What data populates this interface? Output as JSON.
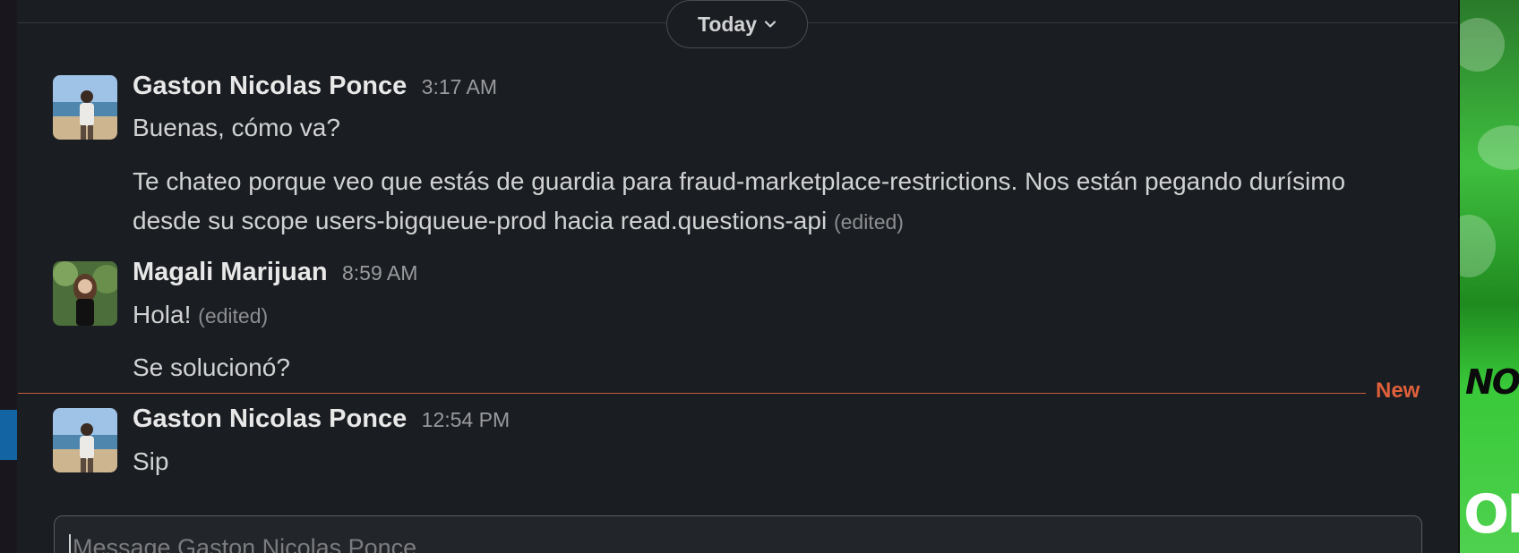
{
  "day_divider": {
    "label": "Today"
  },
  "messages": [
    {
      "author": "Gaston Nicolas Ponce",
      "time": "3:17 AM",
      "lines": [
        "Buenas, cómo va?"
      ],
      "follow_up": {
        "line1": "Te chateo porque veo que estás de guardia para fraud-marketplace-restrictions. Nos están pegando durísimo",
        "line2": "desde su scope users-bigqueue-prod hacia read.questions-api",
        "edited": "(edited)"
      }
    },
    {
      "author": "Magali Marijuan",
      "time": "8:59 AM",
      "line1": "Hola!",
      "line1_edited": "(edited)",
      "line2": "Se solucionó?"
    },
    {
      "author": "Gaston Nicolas Ponce",
      "time": "12:54 PM",
      "line1": "Sip"
    }
  ],
  "new_marker": {
    "label": "New"
  },
  "composer": {
    "placeholder": "Message Gaston Nicolas Ponce"
  },
  "colors": {
    "background": "#1a1d21",
    "new_marker": "#e0603b",
    "accent": "#1264a3"
  },
  "icons": {
    "day_toggle": "chevron-down-icon"
  }
}
